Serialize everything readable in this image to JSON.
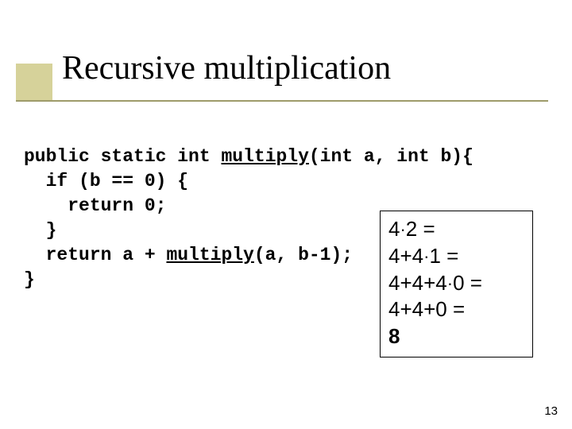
{
  "title": "Recursive multiplication",
  "code": {
    "l1a": "public static int ",
    "l1b": "multiply",
    "l1c": "(int a, int b){",
    "l2": "  if (b == 0) {",
    "l3": "    return 0;",
    "l4": "  }",
    "l5a": "  return a + ",
    "l5b": "multiply",
    "l5c": "(a, b-1);",
    "l6": "}"
  },
  "calc": {
    "r1a": "4",
    "r1b": "2 =",
    "r2a": "4+4",
    "r2b": "1 =",
    "r3a": "4+4+4",
    "r3b": "0 =",
    "r4": "4+4+0 =",
    "r5": "8"
  },
  "dot": "·",
  "page": "13"
}
